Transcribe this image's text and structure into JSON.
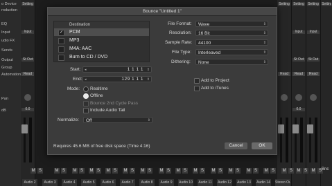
{
  "left_panel": {
    "items": [
      "o Device",
      "roduction",
      "EQ",
      "Input",
      "udio FX",
      "Sends",
      "Output",
      "Group",
      "Automation",
      "Pan",
      "dB"
    ]
  },
  "mixer": {
    "settings_label": "Setting",
    "input_label": "Input",
    "output_label": "St Out",
    "read_label": "Read",
    "volume_value": "0.0",
    "mute": "M",
    "solo": "S",
    "channel_names": [
      "Audio 2",
      "Audio 3",
      "Audio 4",
      "Audio 5",
      "Audio 6",
      "Audio 7",
      "Audio 8",
      "Audio 9",
      "Audio 10",
      "Audio 11",
      "Audio 12",
      "Audio 13",
      "Audio 14",
      "Stereo Ou"
    ],
    "right_partial": "Bnc"
  },
  "dialog": {
    "title": "Bounce \"Untitled 1\"",
    "destination_header": "Destination",
    "destinations": [
      {
        "label": "PCM",
        "checked": true
      },
      {
        "label": "MP3",
        "checked": false
      },
      {
        "label": "M4A: AAC",
        "checked": false
      },
      {
        "label": "Burn to CD / DVD",
        "checked": false
      }
    ],
    "start_label": "Start:",
    "start_value": "1  1  1     1",
    "end_label": "End:",
    "end_value": "129  1  1     1",
    "mode_label": "Mode:",
    "mode_realtime": "Realtime",
    "mode_offline": "Offline",
    "mode_selected": "Offline",
    "bounce_2nd_cycle": "Bounce 2nd Cycle Pass",
    "include_audio_tail": "Include Audio Tail",
    "normalize_label": "Normalize:",
    "normalize_value": "Off",
    "file_format_label": "File Format:",
    "file_format_value": "Wave",
    "resolution_label": "Resolution:",
    "resolution_value": "16 Bit",
    "sample_rate_label": "Sample Rate:",
    "sample_rate_value": "44100",
    "file_type_label": "File Type:",
    "file_type_value": "Interleaved",
    "dithering_label": "Dithering:",
    "dithering_value": "None",
    "add_to_project": "Add to Project",
    "add_to_itunes": "Add to iTunes",
    "disk_space_note": "Requires 45.6 MB of free disk space  (Time 4:16)",
    "cancel_label": "Cancel",
    "ok_label": "OK"
  },
  "colors": {
    "accent": "#eaeaea",
    "dialog_bg": "#3b3b3b"
  }
}
